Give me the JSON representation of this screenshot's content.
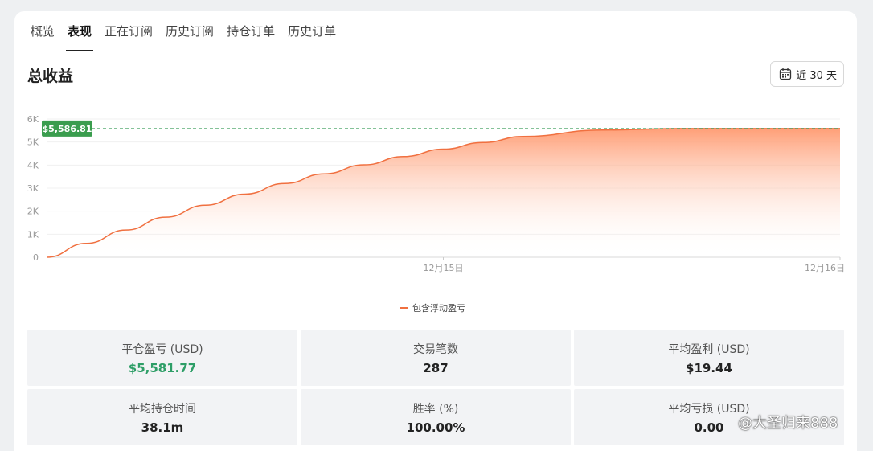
{
  "tabs": [
    {
      "label": "概览"
    },
    {
      "label": "表现"
    },
    {
      "label": "正在订阅"
    },
    {
      "label": "历史订阅"
    },
    {
      "label": "持仓订单"
    },
    {
      "label": "历史订单"
    }
  ],
  "active_tab": "表现",
  "section_title": "总收益",
  "range_button": {
    "label": "近 30 天",
    "icon": "calendar-icon"
  },
  "chart_data": {
    "type": "area",
    "y_tick_labels": [
      "0",
      "1K",
      "2K",
      "3K",
      "4K",
      "5K",
      "6K"
    ],
    "ylim": [
      0,
      6000
    ],
    "x_tick_labels": [
      "12月15日",
      "12月16日"
    ],
    "series": [
      {
        "name": "包含浮动盈亏",
        "color": "#f07040",
        "x_fraction": [
          0,
          0.05,
          0.1,
          0.15,
          0.2,
          0.25,
          0.3,
          0.35,
          0.4,
          0.45,
          0.5,
          0.55,
          0.6,
          0.7,
          0.8,
          0.9,
          1.0
        ],
        "values": [
          0,
          600,
          1180,
          1740,
          2260,
          2740,
          3200,
          3620,
          4010,
          4370,
          4690,
          4980,
          5240,
          5520,
          5586.81,
          5586.81,
          5586.81
        ]
      }
    ],
    "current_value_label": "$5,586.81",
    "current_value": 5586.81,
    "grid": true
  },
  "legend_label": "包含浮动盈亏",
  "stats": [
    {
      "label": "平仓盈亏 (USD)",
      "value": "$5,581.77",
      "color": "#2e9e67"
    },
    {
      "label": "交易笔数",
      "value": "287"
    },
    {
      "label": "平均盈利 (USD)",
      "value": "$19.44"
    },
    {
      "label": "平均持仓时间",
      "value": "38.1m"
    },
    {
      "label": "胜率 (%)",
      "value": "100.00%"
    },
    {
      "label": "平均亏损 (USD)",
      "value": "0.00"
    }
  ],
  "watermark": "@大圣归来888"
}
